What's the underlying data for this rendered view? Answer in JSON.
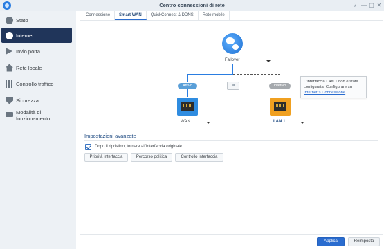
{
  "window": {
    "title": "Centro connessioni di rete",
    "controls": [
      "?",
      "—",
      "▢",
      "✕"
    ]
  },
  "sidebar": {
    "items": [
      {
        "label": "Stato",
        "icon": "status-icon"
      },
      {
        "label": "Internet",
        "icon": "globe-icon",
        "active": true
      },
      {
        "label": "Invio porta",
        "icon": "arrow-icon"
      },
      {
        "label": "Rete locale",
        "icon": "home-icon"
      },
      {
        "label": "Controllo traffico",
        "icon": "traffic-icon"
      },
      {
        "label": "Sicurezza",
        "icon": "shield-icon"
      },
      {
        "label": "Modalità di funzionamento",
        "icon": "router-icon"
      }
    ]
  },
  "tabs": [
    {
      "label": "Connessione"
    },
    {
      "label": "Smart WAN",
      "active": true
    },
    {
      "label": "QuickConnect & DDNS"
    },
    {
      "label": "Rete mobile"
    }
  ],
  "diagram": {
    "mode_label": "Failover",
    "active_badge": "Attivo",
    "inactive_badge": "Inattivo",
    "wan_label": "WAN",
    "lan_label": "LAN 1",
    "balance_icon_text": "⇄",
    "tooltip": {
      "text": "L'interfaccia LAN 1 non è stata configurata. Configurare su",
      "link": "Internet > Connessione",
      "suffix": "."
    }
  },
  "advanced": {
    "title": "Impostazioni avanzate",
    "checkbox_label": "Dopo il ripristino, tornare all'interfaccia originale",
    "checkbox_checked": true,
    "buttons": [
      "Priorità interfaccia",
      "Percorso politica",
      "Controllo interfaccia"
    ]
  },
  "footer": {
    "apply_label": "Applica",
    "reset_label": "Reimposta"
  },
  "colors": {
    "accent": "#2a6ccf",
    "sidebar_active": "#20355a",
    "wan": "#2f8ce0",
    "lan": "#f0a020"
  }
}
